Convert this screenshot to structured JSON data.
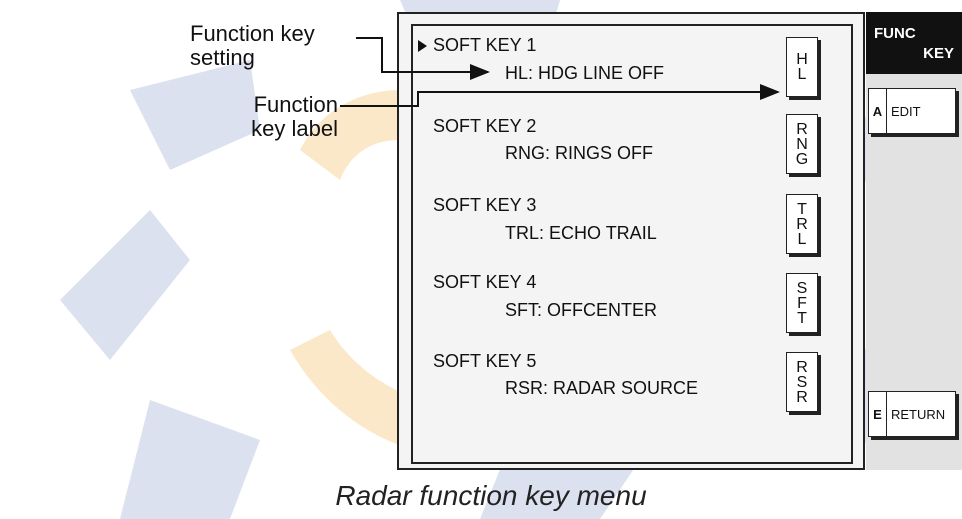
{
  "callouts": {
    "setting_label": "Function key\nsetting",
    "key_label_label": "Function\nkey label"
  },
  "menu": {
    "items": [
      {
        "title": "SOFT KEY 1",
        "setting": "HL: HDG LINE OFF",
        "key": "H\nL"
      },
      {
        "title": "SOFT KEY 2",
        "setting": "RNG: RINGS OFF",
        "key": "R\nN\nG"
      },
      {
        "title": "SOFT KEY 3",
        "setting": "TRL: ECHO TRAIL",
        "key": "T\nR\nL"
      },
      {
        "title": "SOFT KEY 4",
        "setting": "SFT: OFFCENTER",
        "key": "S\nF\nT"
      },
      {
        "title": "SOFT KEY 5",
        "setting": "RSR: RADAR SOURCE",
        "key": "R\nS\nR"
      }
    ],
    "cursor_icon": "triangle-right-icon"
  },
  "side_panel": {
    "header_line1": "FUNC",
    "header_line2": "KEY",
    "buttons": [
      {
        "letter": "A",
        "label": "EDIT"
      },
      {
        "letter": "E",
        "label": "RETURN"
      }
    ]
  },
  "caption": "Radar function key menu",
  "colors": {
    "watermark_blue": "#d5dcec",
    "watermark_orange": "#fbe5c2",
    "header_bg": "#111111"
  }
}
